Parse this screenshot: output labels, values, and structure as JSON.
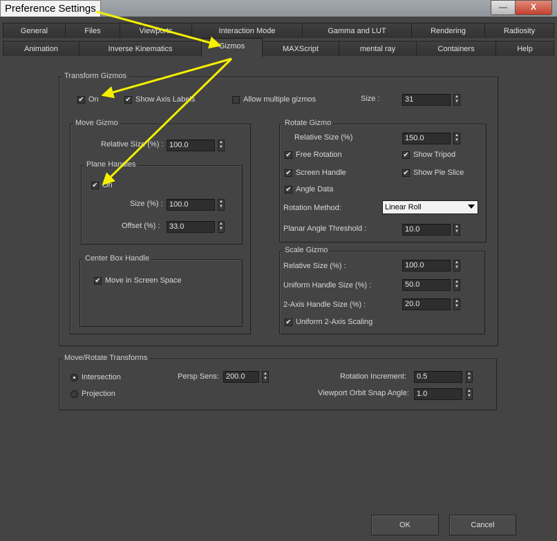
{
  "window": {
    "title": "Preference Settings",
    "minimize": "—",
    "close": "X"
  },
  "tabs_row1": [
    "General",
    "Files",
    "Viewports",
    "Interaction Mode",
    "Gamma and LUT",
    "Rendering",
    "Radiosity"
  ],
  "tabs_row2": [
    "Animation",
    "Inverse Kinematics",
    "Gizmos",
    "MAXScript",
    "mental ray",
    "Containers",
    "Help"
  ],
  "active_tab": "Gizmos",
  "transform_gizmos": {
    "legend": "Transform Gizmos",
    "on_label": "On",
    "on_checked": true,
    "show_axis_label": "Show Axis Labels",
    "show_axis_checked": true,
    "allow_multiple_label": "Allow multiple gizmos",
    "allow_multiple_checked": false,
    "size_label": "Size :",
    "size_value": "31"
  },
  "move_gizmo": {
    "legend": "Move Gizmo",
    "relative_size_label": "Relative Size (%) :",
    "relative_size_value": "100.0",
    "plane_handles": {
      "legend": "Plane Handles",
      "on_label": "On",
      "on_checked": true,
      "size_label": "Size (%) :",
      "size_value": "100.0",
      "offset_label": "Offset (%) :",
      "offset_value": "33.0"
    },
    "center_box": {
      "legend": "Center Box Handle",
      "move_screen_label": "Move in Screen Space",
      "move_screen_checked": true
    }
  },
  "rotate_gizmo": {
    "legend": "Rotate Gizmo",
    "relative_size_label": "Relative Size (%)",
    "relative_size_value": "150.0",
    "free_rotation_label": "Free Rotation",
    "free_rotation_checked": true,
    "show_tripod_label": "Show Tripod",
    "show_tripod_checked": true,
    "screen_handle_label": "Screen Handle",
    "screen_handle_checked": true,
    "show_pie_label": "Show Pie Slice",
    "show_pie_checked": true,
    "angle_data_label": "Angle Data",
    "angle_data_checked": true,
    "rotation_method_label": "Rotation Method:",
    "rotation_method_value": "Linear Roll",
    "planar_angle_label": "Planar Angle Threshold :",
    "planar_angle_value": "10.0"
  },
  "scale_gizmo": {
    "legend": "Scale Gizmo",
    "relative_size_label": "Relative Size (%) :",
    "relative_size_value": "100.0",
    "uniform_handle_label": "Uniform Handle Size (%) :",
    "uniform_handle_value": "50.0",
    "two_axis_label": "2-Axis Handle Size (%) :",
    "two_axis_value": "20.0",
    "uniform_scaling_label": "Uniform 2-Axis Scaling",
    "uniform_scaling_checked": true
  },
  "move_rotate": {
    "legend": "Move/Rotate Transforms",
    "intersection_label": "Intersection",
    "intersection_selected": true,
    "projection_label": "Projection",
    "projection_selected": false,
    "persp_sens_label": "Persp Sens:",
    "persp_sens_value": "200.0",
    "rotation_increment_label": "Rotation Increment:",
    "rotation_increment_value": "0.5",
    "orbit_snap_label": "Viewport Orbit Snap Angle:",
    "orbit_snap_value": "1.0"
  },
  "buttons": {
    "ok": "OK",
    "cancel": "Cancel"
  },
  "annotation_color": "#f5f000"
}
